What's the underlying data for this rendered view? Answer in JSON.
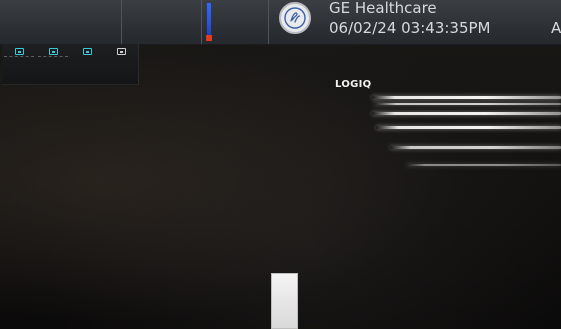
{
  "header": {
    "brand": "GE Healthcare",
    "datetime": "06/02/24 03:43:35PM",
    "corner_letter": "A",
    "logo_icon": "ge-monogram-icon",
    "accent_colors": {
      "depth_bar": "#2f6bff",
      "depth_marker": "#e03a1f"
    }
  },
  "thumbnails": [
    {
      "icon": "image-clip-icon",
      "state": "stored"
    },
    {
      "icon": "image-clip-icon",
      "state": "stored"
    },
    {
      "icon": "image-clip-icon",
      "state": "stored"
    },
    {
      "icon": "image-clip-icon",
      "state": "empty"
    }
  ],
  "viewer": {
    "system_label": "LOGIQ"
  }
}
